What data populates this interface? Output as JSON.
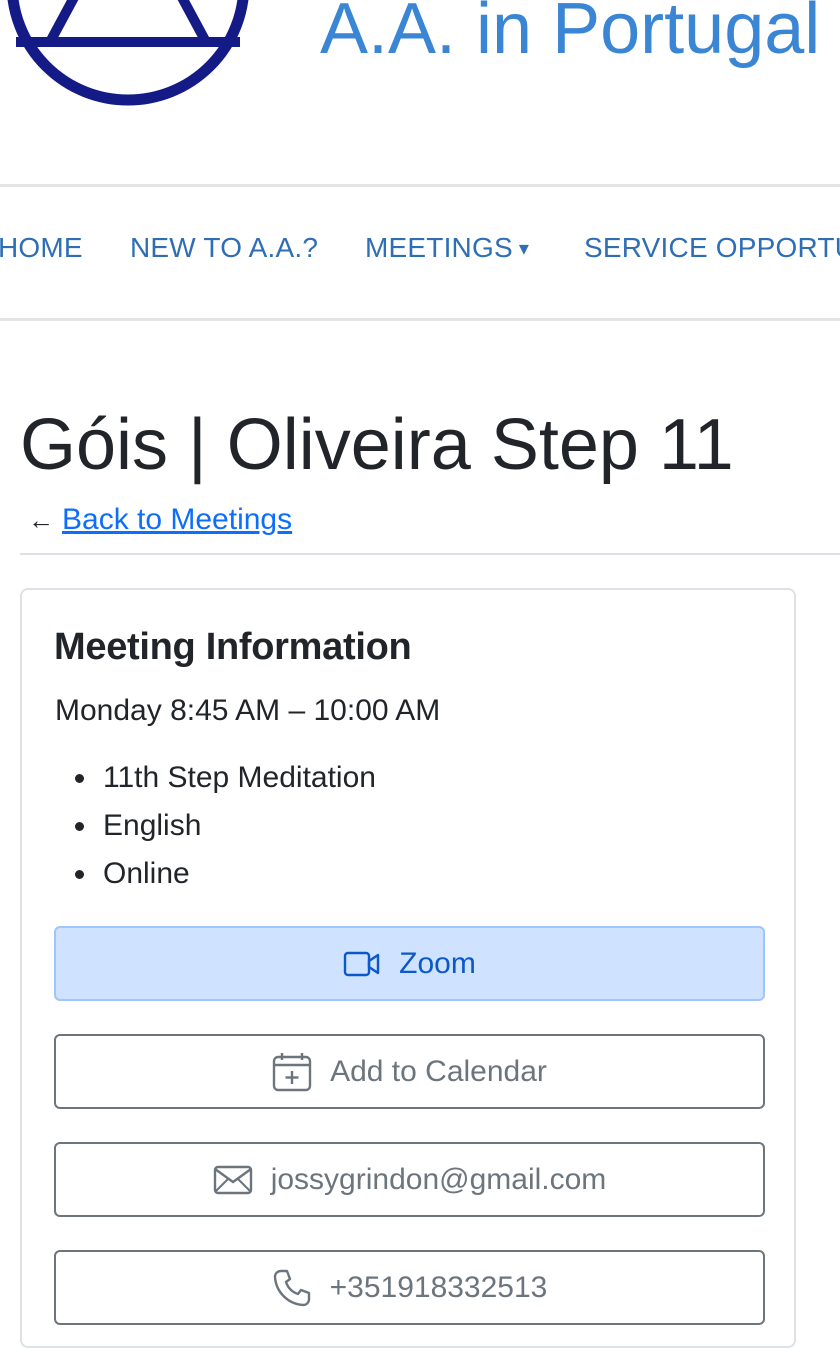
{
  "header": {
    "site_title": "A.A. in Portugal"
  },
  "nav": {
    "items": [
      {
        "label": "HOME"
      },
      {
        "label": "NEW TO A.A.?"
      },
      {
        "label": "MEETINGS",
        "caret": "▾"
      },
      {
        "label": "SERVICE OPPORTUNITIES"
      }
    ]
  },
  "page": {
    "title": "Góis | Oliveira Step 11",
    "back_arrow": "←",
    "back_link": "Back to Meetings"
  },
  "meeting": {
    "heading": "Meeting Information",
    "time": "Monday 8:45 AM – 10:00 AM",
    "types": [
      "11th Step Meditation",
      "English",
      "Online"
    ],
    "buttons": {
      "zoom": {
        "label": "Zoom",
        "icon": "video-icon"
      },
      "calendar": {
        "label": "Add to Calendar",
        "icon": "calendar-plus-icon"
      },
      "email": {
        "label": "jossygrindon@gmail.com",
        "icon": "envelope-icon"
      },
      "phone": {
        "label": "+351918332513",
        "icon": "phone-icon"
      }
    }
  },
  "colors": {
    "logo_navy": "#141a86",
    "title_blue": "#3a86d4",
    "nav_blue": "#2f6eb5",
    "link_blue": "#0d6efd",
    "zoom_bg": "#cfe2ff",
    "zoom_text": "#0a58ca",
    "secondary": "#6c757d"
  }
}
